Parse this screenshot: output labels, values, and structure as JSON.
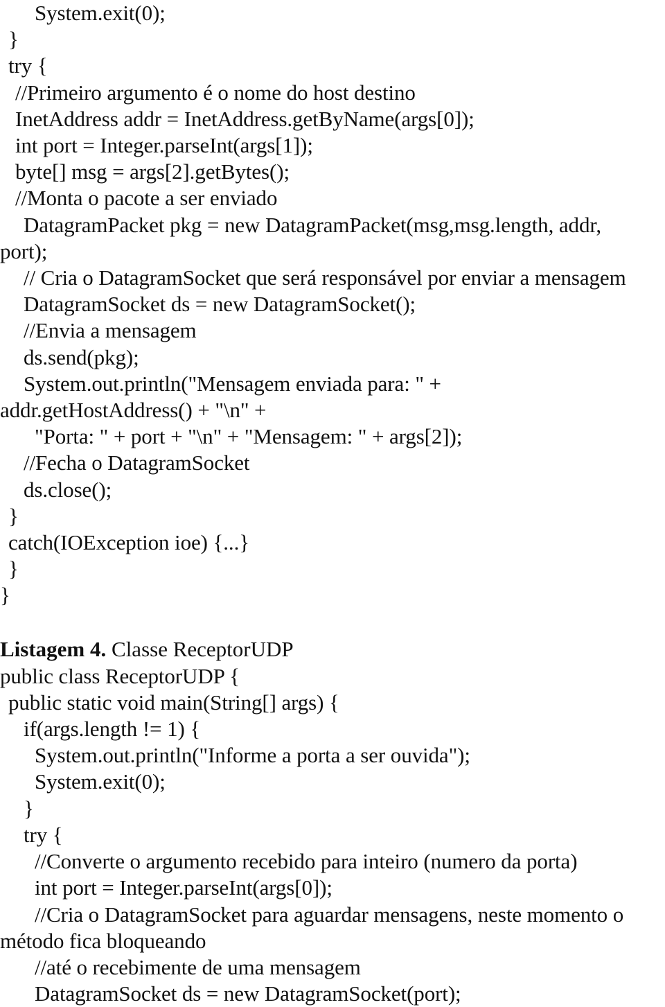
{
  "document": {
    "type": "scanned-code-listing-page",
    "language": "pt-BR",
    "code_language": "Java"
  },
  "listing_emissor_tail": {
    "lines": [
      {
        "indent": 4,
        "text": "System.exit(0);"
      },
      {
        "indent": 1,
        "text": "}"
      },
      {
        "indent": 1,
        "text": "try {"
      },
      {
        "indent": 2,
        "text": "//Primeiro argumento é o nome do host destino"
      },
      {
        "indent": 2,
        "text": "InetAddress addr = InetAddress.getByName(args[0]);"
      },
      {
        "indent": 2,
        "text": "int port = Integer.parseInt(args[1]);"
      },
      {
        "indent": 2,
        "text": "byte[] msg = args[2].getBytes();"
      },
      {
        "indent": 2,
        "text": "//Monta o pacote a ser enviado"
      },
      {
        "indent": 3,
        "text": "DatagramPacket pkg = new DatagramPacket(msg,msg.length, addr,"
      },
      {
        "indent": 0,
        "text": "port);"
      },
      {
        "indent": 3,
        "text": "// Cria o DatagramSocket que será responsável por enviar a mensagem"
      },
      {
        "indent": 3,
        "text": "DatagramSocket ds = new DatagramSocket();"
      },
      {
        "indent": 3,
        "text": "//Envia a mensagem"
      },
      {
        "indent": 3,
        "text": "ds.send(pkg);"
      },
      {
        "indent": 3,
        "text": "System.out.println(\"Mensagem enviada para: \" +"
      },
      {
        "indent": 0,
        "text": "addr.getHostAddress() + \"\\n\" +"
      },
      {
        "indent": 4,
        "text": "\"Porta: \" + port + \"\\n\" + \"Mensagem: \" + args[2]);"
      },
      {
        "indent": 3,
        "text": "//Fecha o DatagramSocket"
      },
      {
        "indent": 3,
        "text": "ds.close();"
      },
      {
        "indent": 1,
        "text": "}"
      },
      {
        "indent": 1,
        "text": "catch(IOException ioe) {...}"
      },
      {
        "indent": 1,
        "text": "}"
      },
      {
        "indent": 0,
        "text": "}"
      }
    ]
  },
  "caption": {
    "label": "Listagem 4.",
    "text": " Classe ReceptorUDP"
  },
  "listing_receptor": {
    "lines": [
      {
        "indent": 0,
        "text": "public class ReceptorUDP {"
      },
      {
        "indent": 1,
        "text": "public static void main(String[] args) {"
      },
      {
        "indent": 3,
        "text": "if(args.length != 1) {"
      },
      {
        "indent": 4,
        "text": "System.out.println(\"Informe a porta a ser ouvida\");"
      },
      {
        "indent": 4,
        "text": "System.exit(0);"
      },
      {
        "indent": 3,
        "text": "}"
      },
      {
        "indent": 3,
        "text": "try {"
      },
      {
        "indent": 4,
        "text": "//Converte o argumento recebido para inteiro (numero da porta)"
      },
      {
        "indent": 4,
        "text": "int port = Integer.parseInt(args[0]);"
      },
      {
        "indent": 4,
        "text": "//Cria o DatagramSocket para aguardar mensagens, neste momento o"
      },
      {
        "indent": 0,
        "text": "método fica bloqueando"
      },
      {
        "indent": 4,
        "text": "//até o recebimente de uma mensagem"
      },
      {
        "indent": 4,
        "text": "DatagramSocket ds = new DatagramSocket(port);"
      }
    ]
  }
}
